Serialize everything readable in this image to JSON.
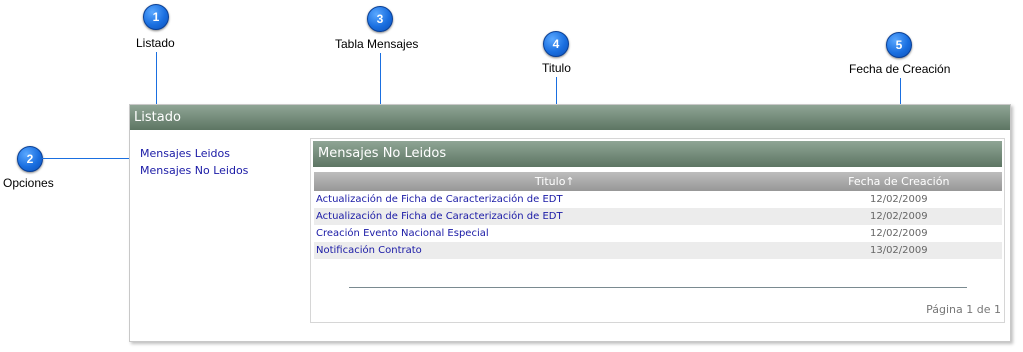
{
  "callouts": [
    {
      "number": "1",
      "label": "Listado"
    },
    {
      "number": "2",
      "label": "Opciones"
    },
    {
      "number": "3",
      "label": "Tabla Mensajes"
    },
    {
      "number": "4",
      "label": "Titulo"
    },
    {
      "number": "5",
      "label": "Fecha de Creación"
    }
  ],
  "panel": {
    "title": "Listado"
  },
  "sidebar": {
    "items": [
      {
        "label": "Mensajes Leidos"
      },
      {
        "label": "Mensajes No Leidos"
      }
    ]
  },
  "inbox": {
    "title": "Mensajes No Leidos",
    "columns": {
      "title": "Titulo↑",
      "date": "Fecha de Creación"
    },
    "rows": [
      {
        "title": "Actualización de Ficha de Caracterización de EDT",
        "date": "12/02/2009"
      },
      {
        "title": "Actualización de Ficha de Caracterización de EDT",
        "date": "12/02/2009"
      },
      {
        "title": "Creación Evento Nacional Especial",
        "date": "12/02/2009"
      },
      {
        "title": "Notificación Contrato",
        "date": "13/02/2009"
      }
    ],
    "pager": "Página 1 de 1"
  },
  "colors": {
    "accent": "#1a6fe0",
    "header": "#6f8774",
    "link": "#1a1aa6"
  }
}
